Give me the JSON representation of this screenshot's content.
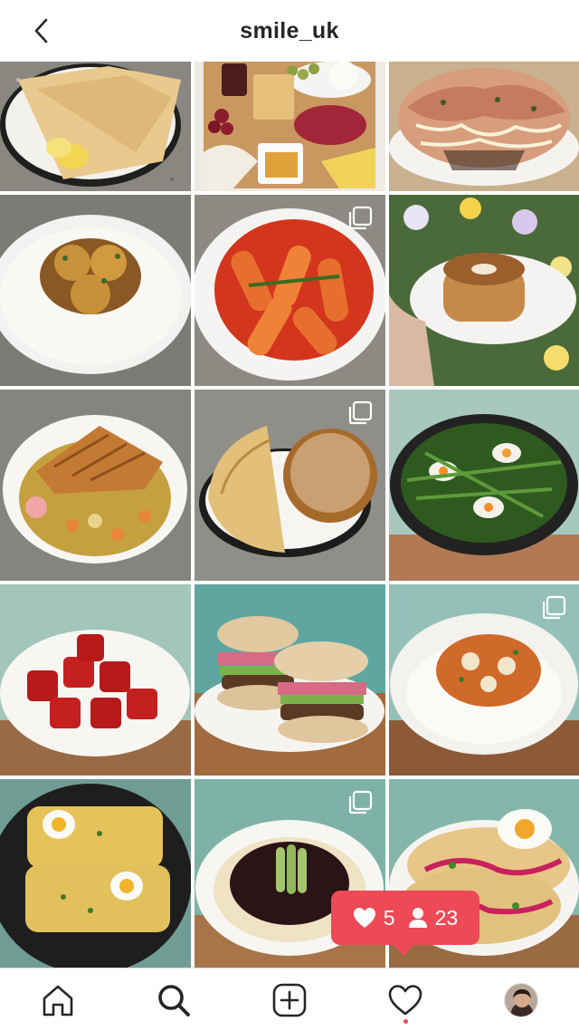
{
  "header": {
    "username": "smile_uk",
    "back_icon": "chevron-left-icon"
  },
  "grid": {
    "tiles": [
      {
        "name": "tile-crepes",
        "multi": false
      },
      {
        "name": "tile-charcuterie-board",
        "multi": false
      },
      {
        "name": "tile-okonomiyaki",
        "multi": false
      },
      {
        "name": "tile-egg-curry-rice",
        "multi": false
      },
      {
        "name": "tile-tteokbokki",
        "multi": true
      },
      {
        "name": "tile-cronut",
        "multi": false
      },
      {
        "name": "tile-katsu-curry",
        "multi": false
      },
      {
        "name": "tile-roti-dip",
        "multi": true
      },
      {
        "name": "tile-skillet-asparagus-eggs",
        "multi": false
      },
      {
        "name": "tile-sticky-tofu",
        "multi": false
      },
      {
        "name": "tile-english-muffin-burgers",
        "multi": false
      },
      {
        "name": "tile-kimchi-rice",
        "multi": true
      },
      {
        "name": "tile-egg-toast-skillet",
        "multi": false
      },
      {
        "name": "tile-jjajangmyeon",
        "multi": true
      },
      {
        "name": "tile-tacos-egg",
        "multi": false
      }
    ]
  },
  "notification": {
    "likes": "5",
    "follows": "23",
    "colors": {
      "badge": "#ed4956"
    }
  },
  "tabbar": {
    "items": [
      {
        "name": "tab-home",
        "icon": "home-icon"
      },
      {
        "name": "tab-search",
        "icon": "search-icon"
      },
      {
        "name": "tab-create",
        "icon": "plus-square-icon"
      },
      {
        "name": "tab-activity",
        "icon": "heart-icon"
      },
      {
        "name": "tab-profile",
        "icon": "avatar"
      }
    ]
  }
}
